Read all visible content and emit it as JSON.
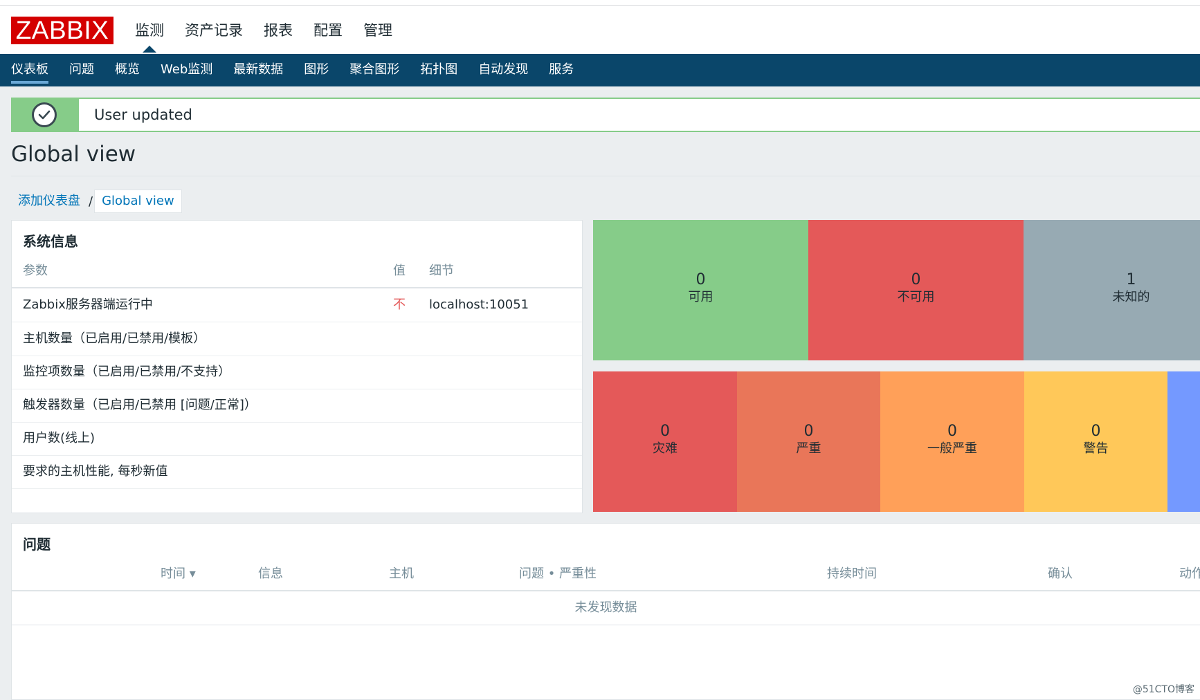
{
  "header": {
    "logo": "ZABBIX",
    "main_menu": [
      {
        "label": "监测",
        "active": true
      },
      {
        "label": "资产记录",
        "active": false
      },
      {
        "label": "报表",
        "active": false
      },
      {
        "label": "配置",
        "active": false
      },
      {
        "label": "管理",
        "active": false
      }
    ],
    "sub_menu": [
      {
        "label": "仪表板",
        "active": true
      },
      {
        "label": "问题"
      },
      {
        "label": "概览"
      },
      {
        "label": "Web监测"
      },
      {
        "label": "最新数据"
      },
      {
        "label": "图形"
      },
      {
        "label": "聚合图形"
      },
      {
        "label": "拓扑图"
      },
      {
        "label": "自动发现"
      },
      {
        "label": "服务"
      }
    ]
  },
  "message": {
    "text": "User updated",
    "icon": "check-circle-icon"
  },
  "page": {
    "title": "Global view"
  },
  "breadcrumb": {
    "parent": "添加仪表盘",
    "separator": "/",
    "current": "Global view"
  },
  "system_info": {
    "title": "系统信息",
    "columns": {
      "param": "参数",
      "value": "值",
      "details": "细节"
    },
    "rows": [
      {
        "param": "Zabbix服务器端运行中",
        "value": "不",
        "details": "localhost:10051"
      },
      {
        "param": "主机数量（已启用/已禁用/模板）",
        "value": "",
        "details": ""
      },
      {
        "param": "监控项数量（已启用/已禁用/不支持）",
        "value": "",
        "details": ""
      },
      {
        "param": "触发器数量（已启用/已禁用 [问题/正常]）",
        "value": "",
        "details": ""
      },
      {
        "param": "用户数(线上)",
        "value": "",
        "details": ""
      },
      {
        "param": "要求的主机性能, 每秒新值",
        "value": "",
        "details": ""
      }
    ]
  },
  "host_availability": [
    {
      "count": "0",
      "label": "可用",
      "color": "#86cc89"
    },
    {
      "count": "0",
      "label": "不可用",
      "color": "#e45959"
    },
    {
      "count": "1",
      "label": "未知的",
      "color": "#97aab3"
    }
  ],
  "problem_severity": [
    {
      "count": "0",
      "label": "灾难",
      "color": "#e45959"
    },
    {
      "count": "0",
      "label": "严重",
      "color": "#e97659"
    },
    {
      "count": "0",
      "label": "一般严重",
      "color": "#ffa059"
    },
    {
      "count": "0",
      "label": "警告",
      "color": "#ffc859"
    },
    {
      "count": "",
      "label": "",
      "color": "#7499ff"
    }
  ],
  "problems": {
    "title": "问题",
    "columns": [
      "时间 ▾",
      "信息",
      "主机",
      "问题 • 严重性",
      "持续时间",
      "确认",
      "动作"
    ],
    "no_data": "未发现数据"
  },
  "watermark": "@51CTO博客"
}
